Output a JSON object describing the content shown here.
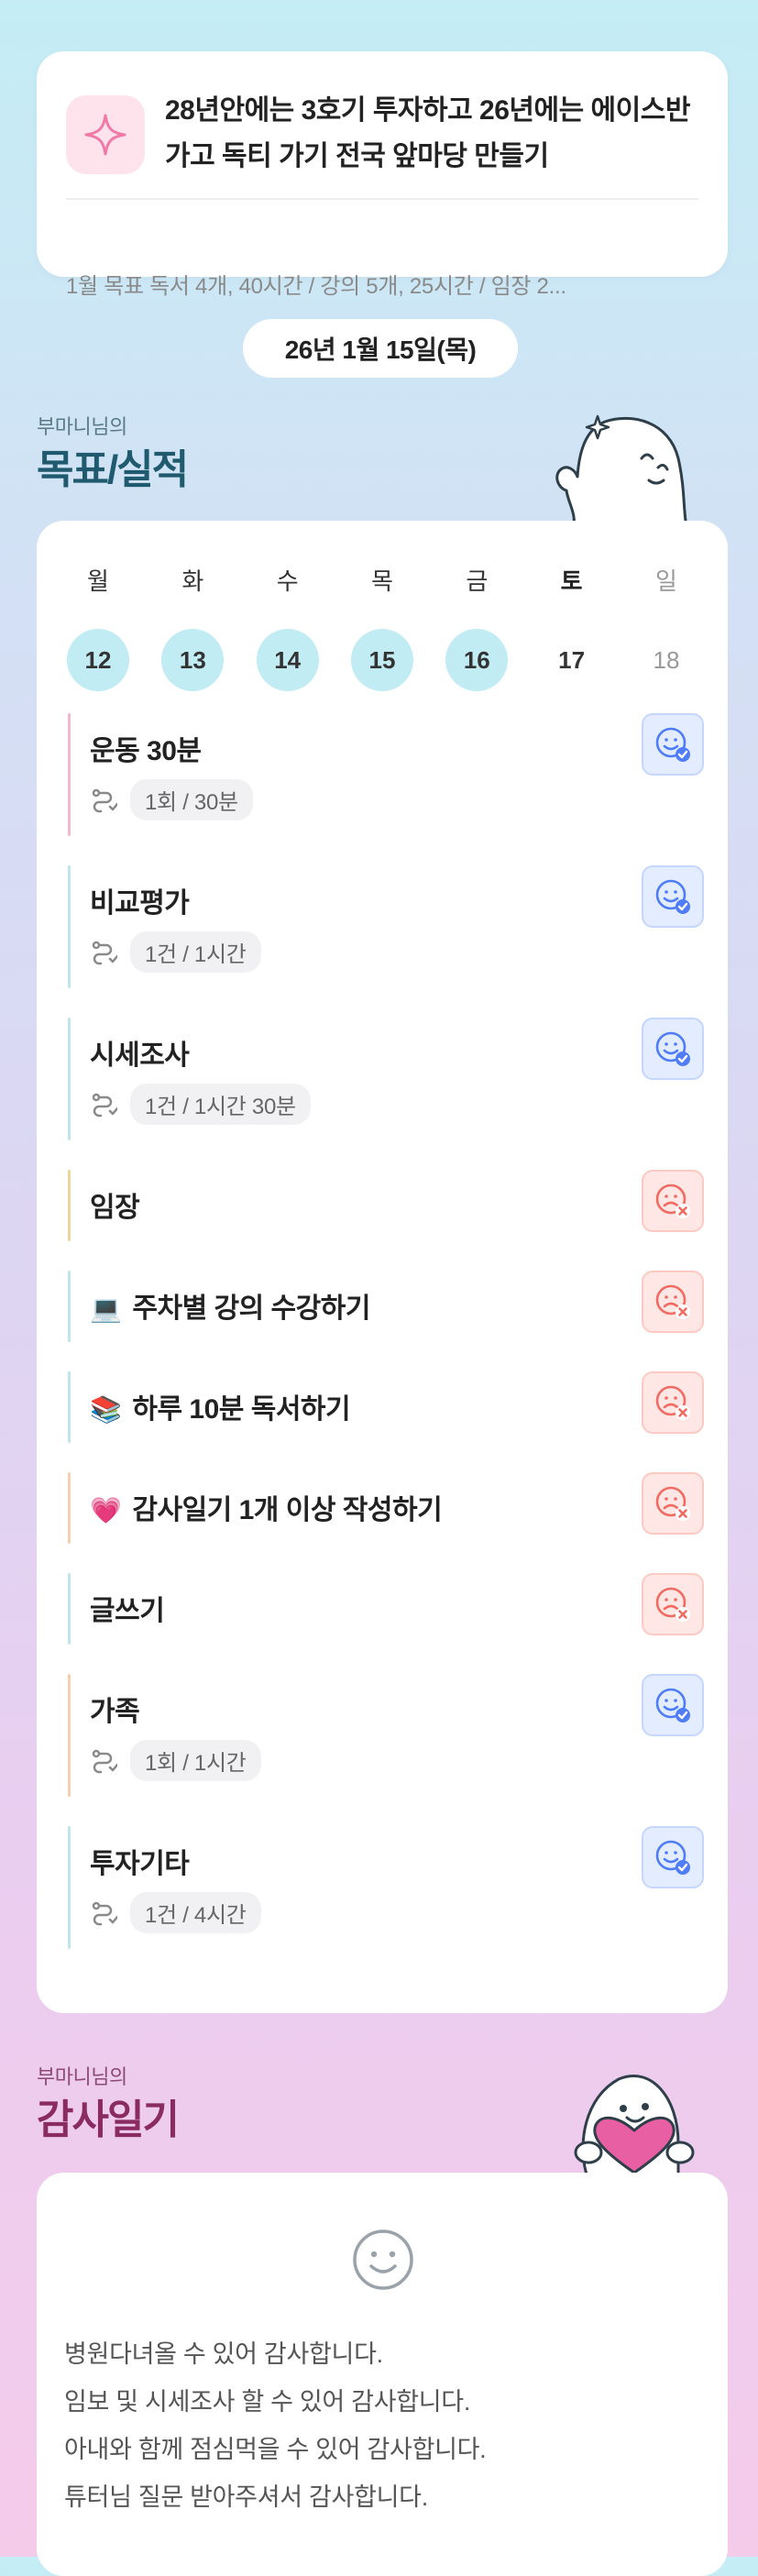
{
  "goal_card": {
    "icon": "sparkle-icon",
    "headline": "28년안에는 3호기 투자하고 26년에는 에이스반 가고 독티 가기 전국 앞마당 만들기",
    "monthly": "1월 목표  독서 4개, 40시간 / 강의 5개, 25시간 / 임장 2..."
  },
  "date_label": "26년 1월 15일(목)",
  "goals_section": {
    "subtitle": "부마니님의",
    "title": "목표/실적"
  },
  "week": [
    {
      "label": "월",
      "date": "12",
      "state": "past"
    },
    {
      "label": "화",
      "date": "13",
      "state": "past"
    },
    {
      "label": "수",
      "date": "14",
      "state": "past"
    },
    {
      "label": "목",
      "date": "15",
      "state": "past"
    },
    {
      "label": "금",
      "date": "16",
      "state": "past"
    },
    {
      "label": "토",
      "date": "17",
      "state": "plain"
    },
    {
      "label": "일",
      "date": "18",
      "state": "sunday"
    }
  ],
  "tasks": [
    {
      "title": "운동 30분",
      "emoji": "",
      "meta": "1회 / 30분",
      "status": "done",
      "bar_color": "#f5b7cf"
    },
    {
      "title": "비교평가",
      "emoji": "",
      "meta": "1건 / 1시간",
      "status": "done",
      "bar_color": "#bfe6ea"
    },
    {
      "title": "시세조사",
      "emoji": "",
      "meta": "1건 / 1시간 30분",
      "status": "done",
      "bar_color": "#bfe6ea"
    },
    {
      "title": "임장",
      "emoji": "",
      "meta": "",
      "status": "fail",
      "bar_color": "#ead59a"
    },
    {
      "title": "주차별 강의 수강하기",
      "emoji": "💻",
      "meta": "",
      "status": "fail",
      "bar_color": "#bfe6ea"
    },
    {
      "title": "하루 10분 독서하기",
      "emoji": "📚",
      "meta": "",
      "status": "fail",
      "bar_color": "#bfe6ea"
    },
    {
      "title": "감사일기 1개 이상 작성하기",
      "emoji": "💗",
      "meta": "",
      "status": "fail",
      "bar_color": "#f7cfae"
    },
    {
      "title": "글쓰기",
      "emoji": "",
      "meta": "",
      "status": "fail",
      "bar_color": "#bfe6ea"
    },
    {
      "title": "가족",
      "emoji": "",
      "meta": "1회 / 1시간",
      "status": "done",
      "bar_color": "#f7cfae"
    },
    {
      "title": "투자기타",
      "emoji": "",
      "meta": "1건 / 4시간",
      "status": "done",
      "bar_color": "#bfe6ea"
    }
  ],
  "gratitude_section": {
    "subtitle": "부마니님의",
    "title": "감사일기",
    "icon": "smiley-icon",
    "lines": [
      "병원다녀올 수 있어 감사합니다.",
      "임보 및 시세조사 할 수 있어 감사합니다.",
      "아내와 함께 점심먹을 수 있어 감사합니다.",
      "튜터님 질문 받아주셔서 감사합니다."
    ]
  },
  "colors": {
    "accent_cyan": "#c1ecf3",
    "done_blue": "#4f7cf7",
    "fail_red": "#f26b62",
    "title_teal": "#1f5a6e",
    "title_plum": "#8a2b63"
  }
}
